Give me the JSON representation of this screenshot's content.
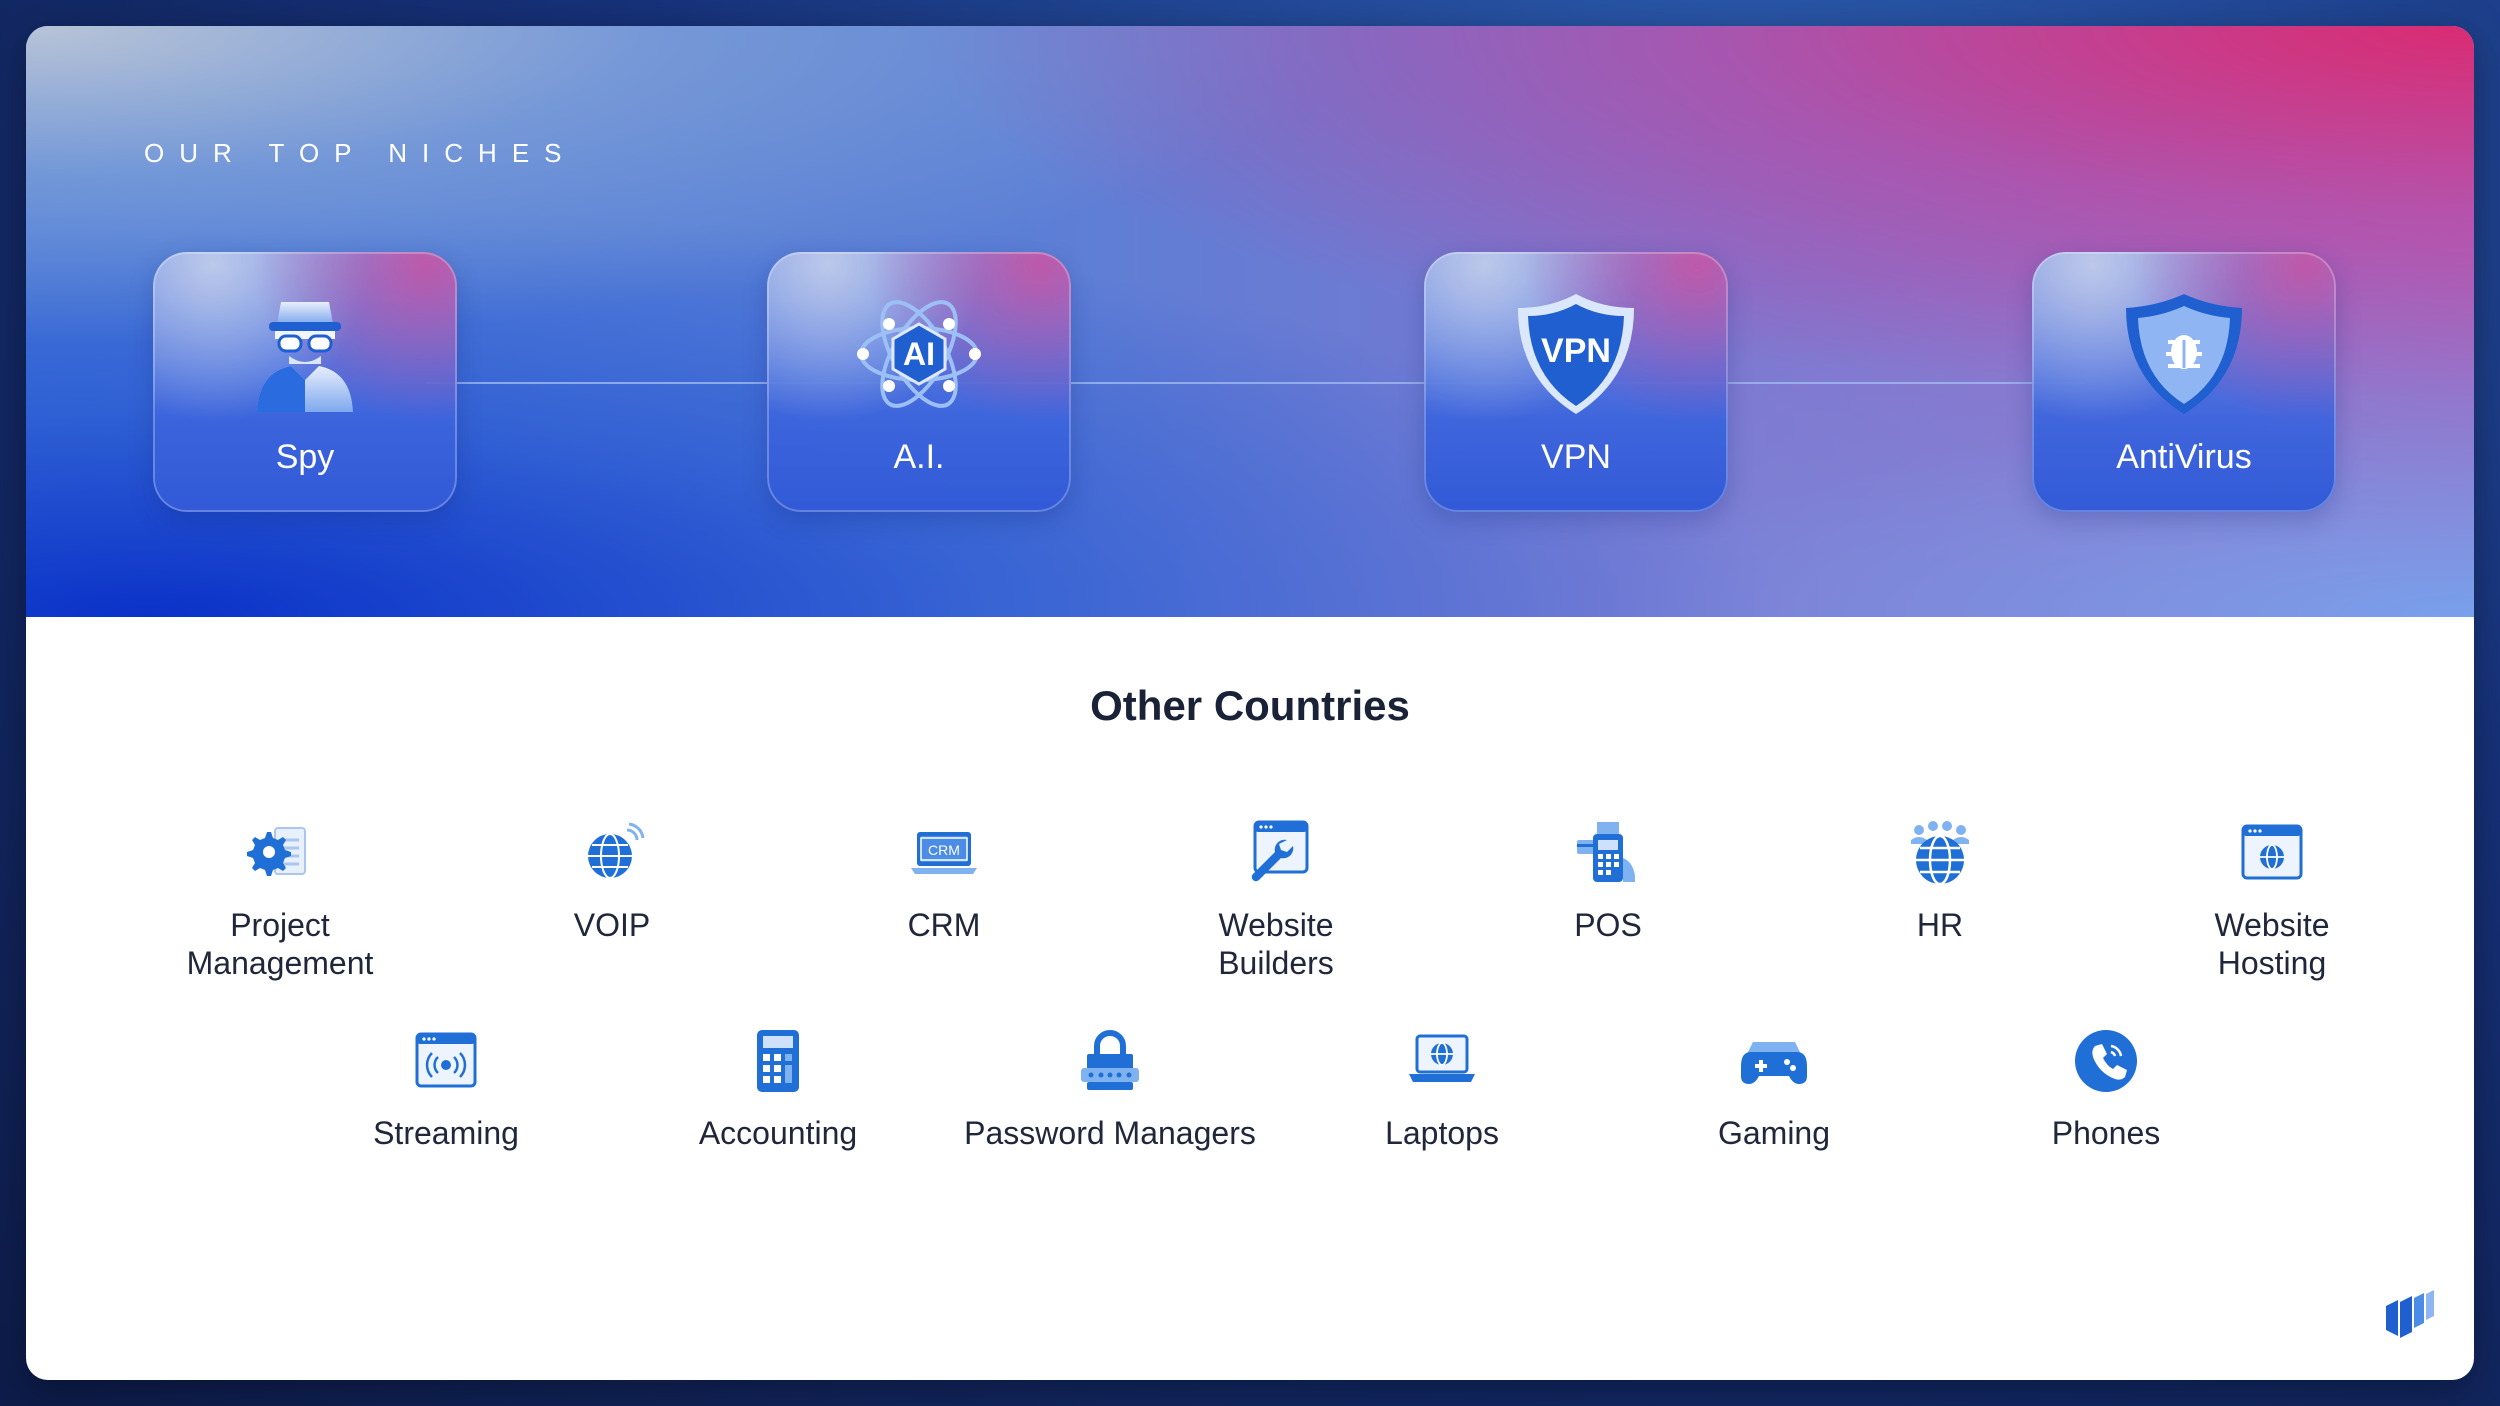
{
  "hero": {
    "eyebrow": "OUR TOP NICHES",
    "niches": [
      {
        "label": "Spy",
        "icon": "spy-icon"
      },
      {
        "label": "A.I.",
        "icon": "ai-atom-icon"
      },
      {
        "label": "VPN",
        "icon": "vpn-shield-icon"
      },
      {
        "label": "AntiVirus",
        "icon": "antivirus-shield-icon"
      }
    ]
  },
  "section": {
    "title": "Other Countries"
  },
  "categories_row1": [
    {
      "label": "Project\nManagement",
      "icon": "project-management-icon"
    },
    {
      "label": "VOIP",
      "icon": "voip-globe-icon"
    },
    {
      "label": "CRM",
      "icon": "crm-laptop-icon"
    },
    {
      "label": "Website\nBuilders",
      "icon": "website-builder-icon"
    },
    {
      "label": "POS",
      "icon": "pos-terminal-icon"
    },
    {
      "label": "HR",
      "icon": "hr-people-globe-icon"
    },
    {
      "label": "Website\nHosting",
      "icon": "website-hosting-icon"
    }
  ],
  "categories_row2": [
    {
      "label": "Streaming",
      "icon": "streaming-icon"
    },
    {
      "label": "Accounting",
      "icon": "calculator-icon"
    },
    {
      "label": "Password Managers",
      "icon": "password-lock-icon"
    },
    {
      "label": "Laptops",
      "icon": "laptop-globe-icon"
    },
    {
      "label": "Gaming",
      "icon": "gamepad-icon"
    },
    {
      "label": "Phones",
      "icon": "phone-icon"
    }
  ],
  "colors": {
    "icon_primary": "#1f6fd6",
    "icon_light": "#7fb2f0",
    "title_text": "#1a2238"
  }
}
